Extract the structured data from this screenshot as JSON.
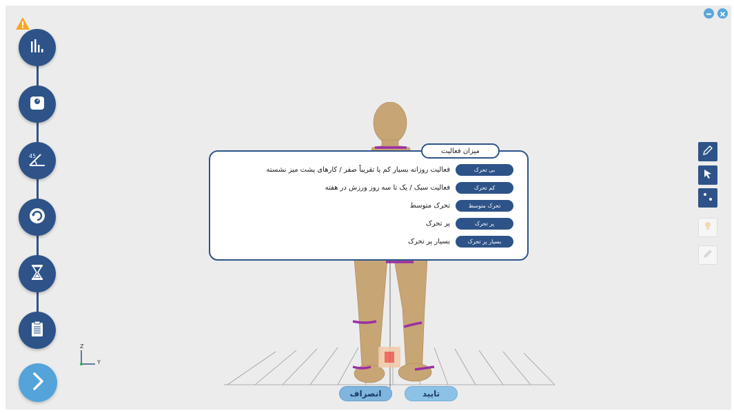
{
  "window": {
    "minimize_icon": "minus-icon",
    "close_icon": "close-icon"
  },
  "sidebar": {
    "warning_icon": "warning-icon",
    "items": [
      {
        "icon": "bar-chart-icon"
      },
      {
        "icon": "scale-icon"
      },
      {
        "icon": "angle-icon",
        "label": "45"
      },
      {
        "icon": "rotate-icon"
      },
      {
        "icon": "hourglass-icon"
      },
      {
        "icon": "clipboard-icon"
      }
    ],
    "next_icon": "chevron-right-icon"
  },
  "tools": [
    {
      "icon": "pencil-icon"
    },
    {
      "icon": "cursor-arrow-icon"
    },
    {
      "icon": "points-icon"
    },
    {
      "icon": "lightbulb-icon"
    },
    {
      "icon": "edit-icon"
    }
  ],
  "axis": {
    "z_label": "Z",
    "y_label": "Y"
  },
  "dialog": {
    "title": "میزان فعالیت",
    "options": [
      {
        "label": "بی تحرک",
        "description": "فعالیت روزانه بسیار کم یا تقریباً صفر / کارهای پشت میز نشسته"
      },
      {
        "label": "کم تحرک",
        "description": "فعالیت سبک / یک تا سه روز ورزش در هفته"
      },
      {
        "label": "تحرک متوسط",
        "description": "تحرک متوسط"
      },
      {
        "label": "پر تحرک",
        "description": "پر تحرک"
      },
      {
        "label": "بسیار پر تحرک",
        "description": "بسیار پر تحرک"
      }
    ]
  },
  "footer": {
    "cancel_label": "انصراف",
    "confirm_label": "تایید"
  },
  "colors": {
    "primary": "#2d5389",
    "accent": "#54a4da",
    "warning": "#f5a623",
    "body": "#c7a575",
    "marker": "#9b2fa5"
  }
}
